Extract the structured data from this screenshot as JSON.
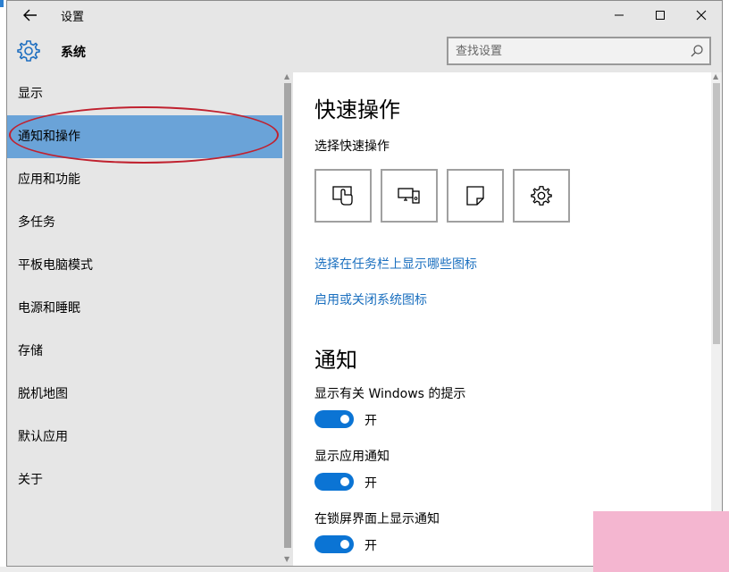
{
  "window": {
    "title": "设置",
    "back_icon": "arrow-left-icon",
    "minimize_icon": "minimize-icon",
    "maximize_icon": "maximize-icon",
    "close_icon": "close-icon"
  },
  "header": {
    "title": "系统",
    "icon": "gear-icon",
    "search_placeholder": "查找设置",
    "search_icon": "search-icon"
  },
  "sidebar": {
    "items": [
      {
        "label": "显示",
        "active": false
      },
      {
        "label": "通知和操作",
        "active": true
      },
      {
        "label": "应用和功能",
        "active": false
      },
      {
        "label": "多任务",
        "active": false
      },
      {
        "label": "平板电脑模式",
        "active": false
      },
      {
        "label": "电源和睡眠",
        "active": false
      },
      {
        "label": "存储",
        "active": false
      },
      {
        "label": "脱机地图",
        "active": false
      },
      {
        "label": "默认应用",
        "active": false
      },
      {
        "label": "关于",
        "active": false
      }
    ]
  },
  "content": {
    "quick_actions_heading": "快速操作",
    "quick_actions_subtitle": "选择快速操作",
    "quick_action_tiles": [
      {
        "icon": "tablet-mode-icon"
      },
      {
        "icon": "connect-display-icon"
      },
      {
        "icon": "note-icon"
      },
      {
        "icon": "settings-gear-icon"
      }
    ],
    "link_taskbar_icons": "选择在任务栏上显示哪些图标",
    "link_system_icons": "启用或关闭系统图标",
    "notifications_heading": "通知",
    "toggles": [
      {
        "label": "显示有关 Windows 的提示",
        "state": "开",
        "on": true
      },
      {
        "label": "显示应用通知",
        "state": "开",
        "on": true
      },
      {
        "label": "在锁屏界面上显示通知",
        "state": "开",
        "on": true
      }
    ]
  },
  "colors": {
    "accent": "#0b74d4",
    "selection": "#6aa3d8",
    "annotation": "#c0212f",
    "link": "#1a6fbf"
  }
}
